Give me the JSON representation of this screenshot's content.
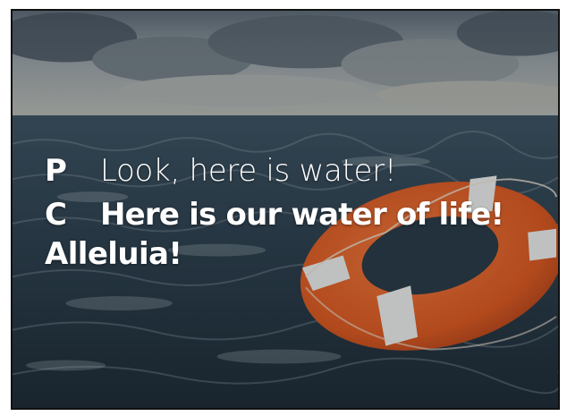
{
  "slide": {
    "leader": {
      "speaker": "P",
      "text": "Look, here is water!"
    },
    "congregation": {
      "speaker": "C",
      "text": "Here is our water of life!",
      "continuation": "Alleluia!"
    }
  },
  "colors": {
    "sky": "#9aa6ae",
    "sea": "#2c3d4a",
    "lifebuoy_orange": "#e2622b",
    "lifebuoy_stripe": "#e9ecec",
    "text": "#ffffff"
  }
}
